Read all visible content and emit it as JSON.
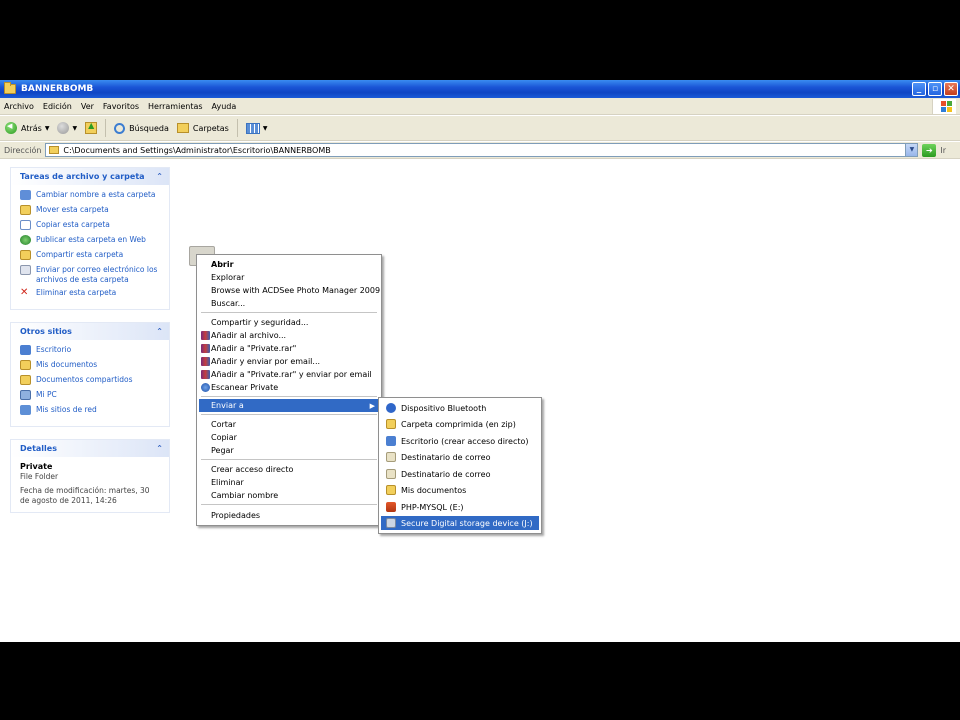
{
  "window": {
    "title": "BANNERBOMB"
  },
  "title_buttons": {
    "minimize": "_",
    "maximize": "▫",
    "close": "✕"
  },
  "menubar": [
    "Archivo",
    "Edición",
    "Ver",
    "Favoritos",
    "Herramientas",
    "Ayuda"
  ],
  "toolbar": {
    "back_label": "Atrás",
    "search_label": "Búsqueda",
    "folders_label": "Carpetas"
  },
  "address": {
    "label": "Dirección",
    "path": "C:\\Documents and Settings\\Administrator\\Escritorio\\BANNERBOMB",
    "go_label": "Ir"
  },
  "tasks_panel": {
    "title": "Tareas de archivo y carpeta",
    "items": [
      "Cambiar nombre a esta carpeta",
      "Mover esta carpeta",
      "Copiar esta carpeta",
      "Publicar esta carpeta en Web",
      "Compartir esta carpeta",
      "Enviar por correo electrónico los archivos de esta carpeta",
      "Eliminar esta carpeta"
    ]
  },
  "places_panel": {
    "title": "Otros sitios",
    "items": [
      "Escritorio",
      "Mis documentos",
      "Documentos compartidos",
      "Mi PC",
      "Mis sitios de red"
    ]
  },
  "details_panel": {
    "title": "Detalles",
    "name": "Private",
    "type": "File Folder",
    "modified": "Fecha de modificación: martes, 30 de agosto de 2011, 14:26"
  },
  "context_menu": {
    "items": [
      "Abrir",
      "Explorar",
      "Browse with ACDSee Photo Manager 2009",
      "Buscar...",
      "Compartir y seguridad...",
      "Añadir al archivo...",
      "Añadir a \"Private.rar\"",
      "Añadir y enviar por email...",
      "Añadir a \"Private.rar\" y enviar por email",
      "Escanear Private",
      "Enviar a",
      "Cortar",
      "Copiar",
      "Pegar",
      "Crear acceso directo",
      "Eliminar",
      "Cambiar nombre",
      "Propiedades"
    ]
  },
  "send_to_menu": {
    "items": [
      "Dispositivo Bluetooth",
      "Carpeta comprimida (en zip)",
      "Escritorio (crear acceso directo)",
      "Destinatario de correo",
      "Destinatario de correo",
      "Mis documentos",
      "PHP-MYSQL (E:)",
      "Secure Digital storage device (J:)"
    ]
  },
  "colors": {
    "highlight": "#316ac5",
    "link": "#215dc6",
    "titlebar": "#0f45c4"
  }
}
